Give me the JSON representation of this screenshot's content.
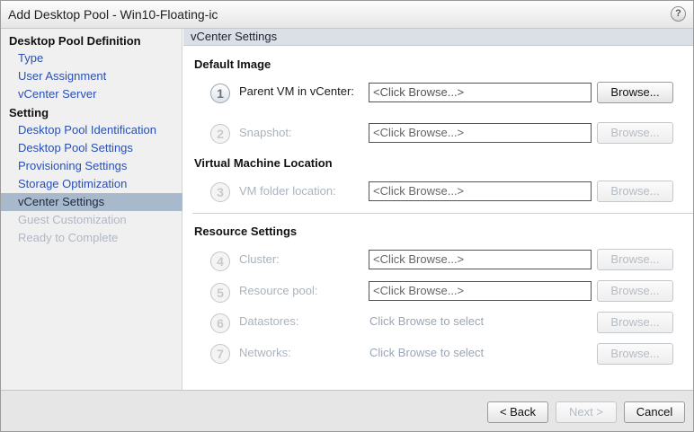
{
  "titlebar": {
    "title": "Add Desktop Pool - Win10-Floating-ic",
    "help_glyph": "?"
  },
  "sidebar": {
    "groups": [
      {
        "heading": "Desktop Pool Definition",
        "items": [
          {
            "label": "Type",
            "state": "link"
          },
          {
            "label": "User Assignment",
            "state": "link"
          },
          {
            "label": "vCenter Server",
            "state": "link"
          }
        ]
      },
      {
        "heading": "Setting",
        "items": [
          {
            "label": "Desktop Pool Identification",
            "state": "link"
          },
          {
            "label": "Desktop Pool Settings",
            "state": "link"
          },
          {
            "label": "Provisioning Settings",
            "state": "link"
          },
          {
            "label": "Storage Optimization",
            "state": "link"
          },
          {
            "label": "vCenter Settings",
            "state": "active"
          },
          {
            "label": "Guest Customization",
            "state": "disabled"
          },
          {
            "label": "Ready to Complete",
            "state": "disabled"
          }
        ]
      }
    ]
  },
  "main": {
    "header": "vCenter Settings",
    "sections": {
      "default_image": "Default Image",
      "vm_location": "Virtual Machine Location",
      "resource_settings": "Resource Settings"
    },
    "rows": [
      {
        "step": "1",
        "label": "Parent VM in vCenter:",
        "value": "<Click Browse...>",
        "button": "Browse...",
        "enabled": true,
        "kind": "field"
      },
      {
        "step": "2",
        "label": "Snapshot:",
        "value": "<Click Browse...>",
        "button": "Browse...",
        "enabled": false,
        "kind": "field"
      },
      {
        "step": "3",
        "label": "VM folder location:",
        "value": "<Click Browse...>",
        "button": "Browse...",
        "enabled": false,
        "kind": "field"
      },
      {
        "step": "4",
        "label": "Cluster:",
        "value": "<Click Browse...>",
        "button": "Browse...",
        "enabled": false,
        "kind": "field"
      },
      {
        "step": "5",
        "label": "Resource pool:",
        "value": "<Click Browse...>",
        "button": "Browse...",
        "enabled": false,
        "kind": "field"
      },
      {
        "step": "6",
        "label": "Datastores:",
        "value": "Click Browse to select",
        "button": "Browse...",
        "enabled": false,
        "kind": "text"
      },
      {
        "step": "7",
        "label": "Networks:",
        "value": "Click Browse to select",
        "button": "Browse...",
        "enabled": false,
        "kind": "text"
      }
    ]
  },
  "footer": {
    "back": "< Back",
    "next": "Next >",
    "cancel": "Cancel"
  },
  "colors": {
    "sidebar_active_bg": "#a9b9cc",
    "link": "#2a50b0",
    "disabled_text": "#b0b8c4",
    "header_bg": "#dbe0e6"
  }
}
